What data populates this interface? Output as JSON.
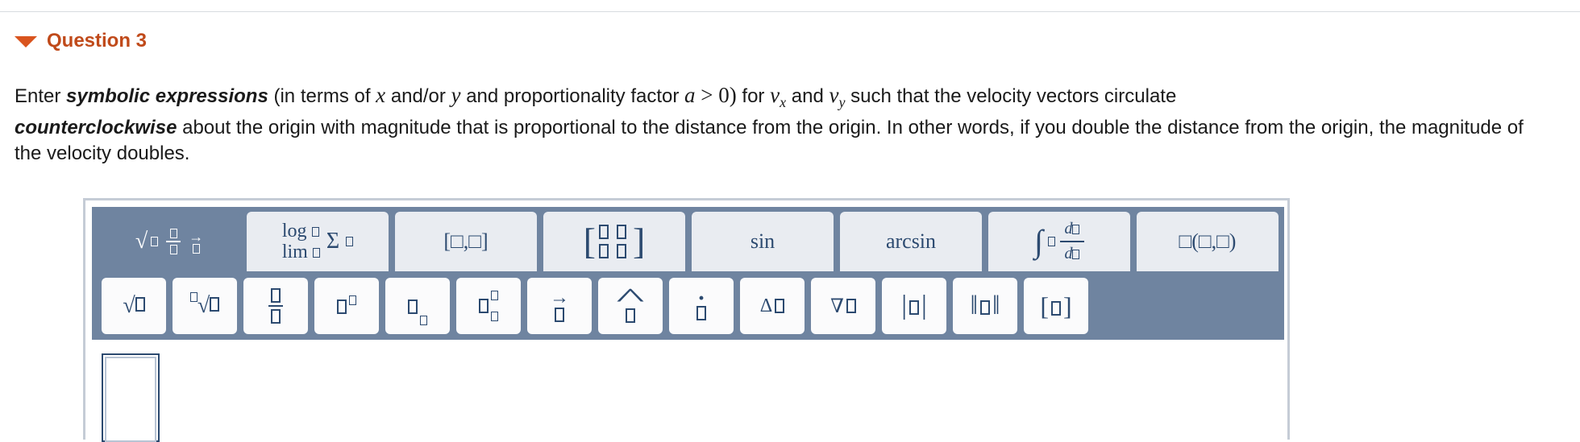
{
  "question": {
    "title": "Question 3",
    "prompt": {
      "p1": "Enter ",
      "em1": "symbolic expressions",
      "p2": " (in terms of ",
      "x": "x",
      "p3": " and/or ",
      "y": "y",
      "p4": " and proportionality factor ",
      "a": "a",
      "gt0": " > 0)",
      "p5": " for ",
      "vx_v": "v",
      "vx_sub": "x",
      "p6": " and ",
      "vy_v": "v",
      "vy_sub": "y",
      "p7": " such that the velocity vectors circulate ",
      "em2": "counterclockwise",
      "p8": " about the origin with magnitude that is proportional to the distance from the origin. In other words, if you double the distance from the origin, the magnitude of the velocity doubles."
    }
  },
  "editor": {
    "tabs": [
      {
        "id": "basic",
        "active": true
      },
      {
        "id": "functions",
        "label_top": "log",
        "label_bot": "lim",
        "sym": "Σ"
      },
      {
        "id": "vector",
        "label": "[□,□]"
      },
      {
        "id": "matrix"
      },
      {
        "id": "trig",
        "label": "sin"
      },
      {
        "id": "inverse-trig",
        "label": "arcsin"
      },
      {
        "id": "calculus",
        "sym": "∫",
        "d": "d"
      },
      {
        "id": "function-call",
        "label": "□(□,□)"
      }
    ],
    "buttons": [
      {
        "id": "sqrt",
        "sym": "√"
      },
      {
        "id": "nth-root",
        "sym": "√"
      },
      {
        "id": "fraction"
      },
      {
        "id": "superscript"
      },
      {
        "id": "subscript"
      },
      {
        "id": "sub-superscript"
      },
      {
        "id": "vector-arrow",
        "sym": "→"
      },
      {
        "id": "unit-vector-hat",
        "sym": "^"
      },
      {
        "id": "dot-derivative",
        "sym": "·"
      },
      {
        "id": "delta",
        "sym": "Δ"
      },
      {
        "id": "nabla",
        "sym": "∇"
      },
      {
        "id": "absolute-value",
        "sym": "|"
      },
      {
        "id": "norm",
        "sym": "‖"
      },
      {
        "id": "brackets",
        "left": "[",
        "right": "]"
      }
    ]
  }
}
